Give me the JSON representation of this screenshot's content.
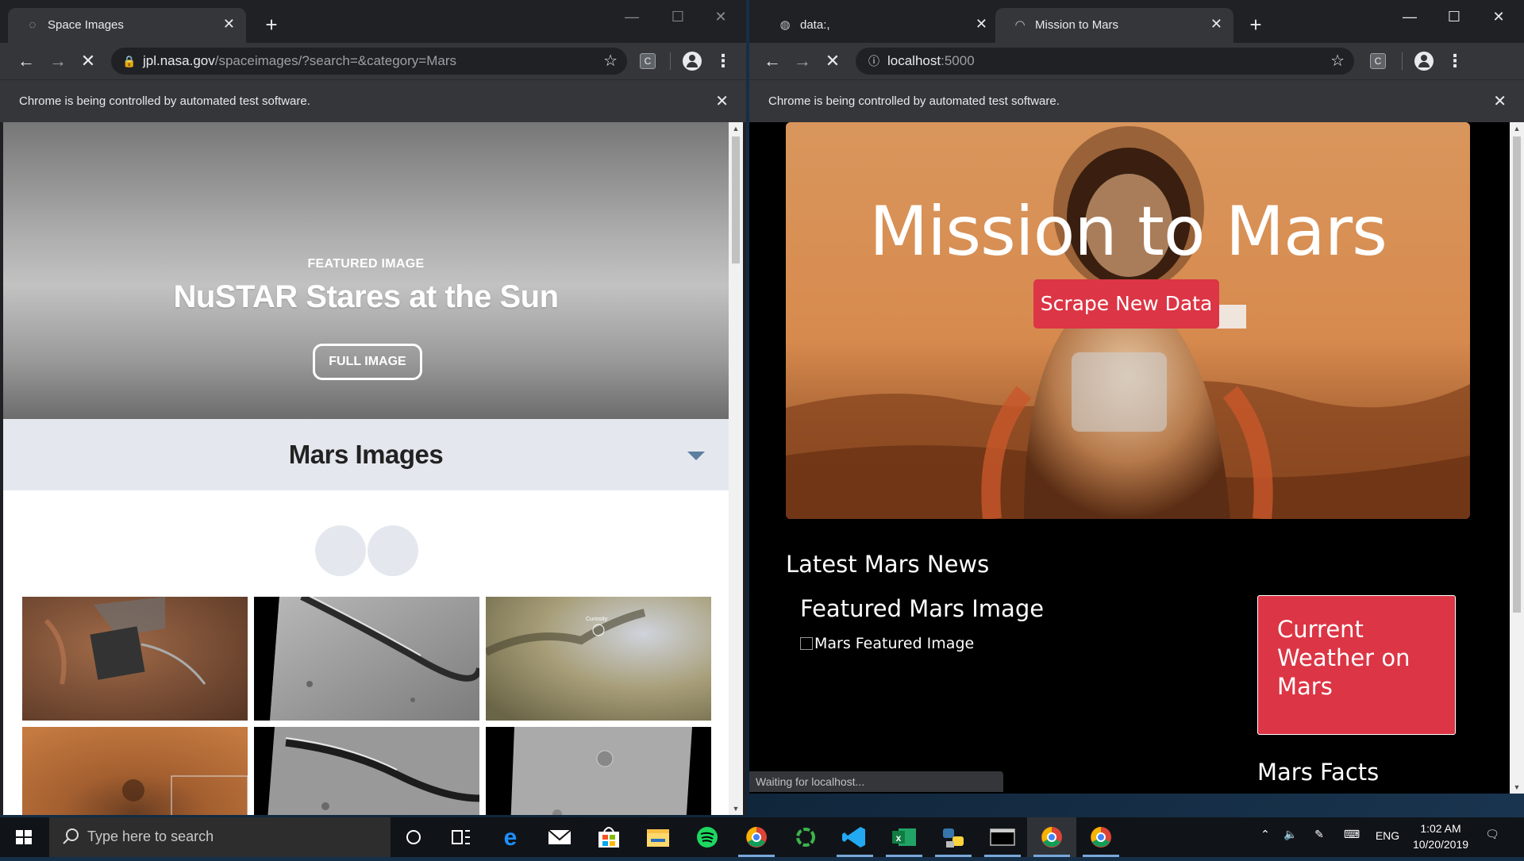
{
  "left_window": {
    "tab": {
      "title": "Space Images"
    },
    "url_host": "jpl.nasa.gov",
    "url_path": "/spaceimages/?search=&category=Mars",
    "infobar": "Chrome is being controlled by automated test software.",
    "extension_label": "C",
    "page": {
      "kicker": "FEATURED IMAGE",
      "headline": "NuSTAR Stares at the Sun",
      "button": "FULL IMAGE",
      "gallery_title": "Mars Images",
      "thumb_label": "Curiosity"
    }
  },
  "right_window": {
    "tabs": [
      {
        "title": "data:,"
      },
      {
        "title": "Mission to Mars"
      }
    ],
    "url_host": "localhost",
    "url_path": ":5000",
    "infobar": "Chrome is being controlled by automated test software.",
    "extension_label": "C",
    "page": {
      "title": "Mission to Mars",
      "scrape_button": "Scrape New Data",
      "latest_news": "Latest Mars News",
      "featured_image": "Featured Mars Image",
      "featured_alt": "Mars Featured Image",
      "weather": "Current Weather on Mars",
      "facts": "Mars Facts"
    },
    "status": "Waiting for localhost..."
  },
  "taskbar": {
    "search_placeholder": "Type here to search",
    "language": "ENG",
    "time": "1:02 AM",
    "date": "10/20/2019"
  },
  "colors": {
    "chrome_dark": "#202124",
    "chrome_toolbar": "#35363a",
    "bootstrap_danger": "#dc3545",
    "gallery_header": "#e4e8ee"
  }
}
